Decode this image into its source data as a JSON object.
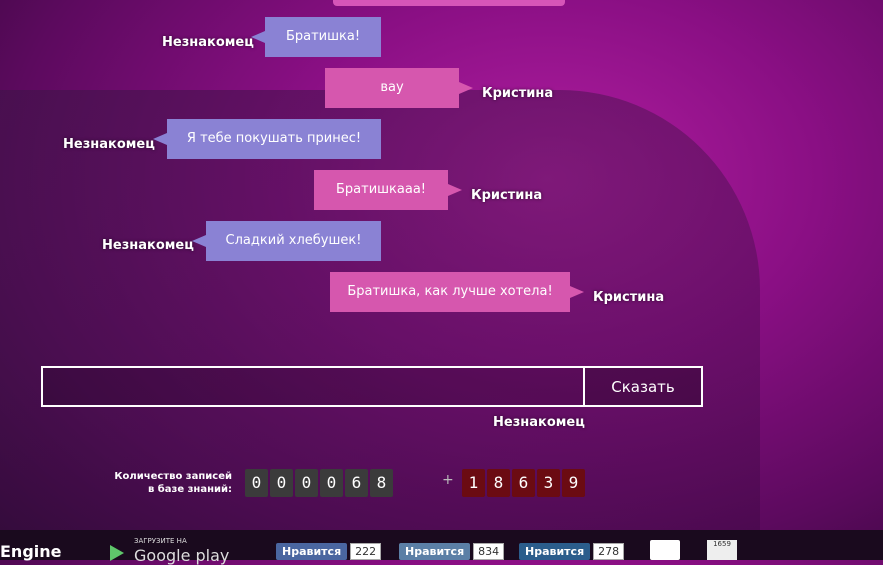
{
  "chat": {
    "messages": [
      {
        "speaker": "Незнакомец",
        "text": "Братишка!",
        "side": "left"
      },
      {
        "speaker": "Кристина",
        "text": "вау",
        "side": "right"
      },
      {
        "speaker": "Незнакомец",
        "text": "Я тебе покушать принес!",
        "side": "left"
      },
      {
        "speaker": "Кристина",
        "text": "Братишкааа!",
        "side": "right"
      },
      {
        "speaker": "Незнакомец",
        "text": "Сладкий хлебушек!",
        "side": "left"
      },
      {
        "speaker": "Кристина",
        "text": "Братишка, как лучше хотела!",
        "side": "right"
      }
    ],
    "input_value": "",
    "send_label": "Сказать",
    "mode_label": "Незнакомец"
  },
  "counter": {
    "label": "Количество записей в базе знаний:",
    "records_digits": [
      "0",
      "0",
      "0",
      "0",
      "6",
      "8"
    ],
    "plus": "+",
    "total_digits": [
      "1",
      "8",
      "6",
      "3",
      "9"
    ]
  },
  "footer": {
    "engine_label": "Engine",
    "google_play_small": "ЗАГРУЗИТЕ НА",
    "google_play_big": "Google play",
    "facebook": {
      "label": "Нравится",
      "count": "222"
    },
    "vk": {
      "label": "Нравится",
      "count": "834"
    },
    "mailru": {
      "label": "Нравится",
      "count": "278"
    },
    "stats_counter": "1659"
  },
  "colors": {
    "background": "#8a0f84",
    "stranger_bubble": "#8a82d4",
    "kristina_bubble": "#d657ae"
  }
}
